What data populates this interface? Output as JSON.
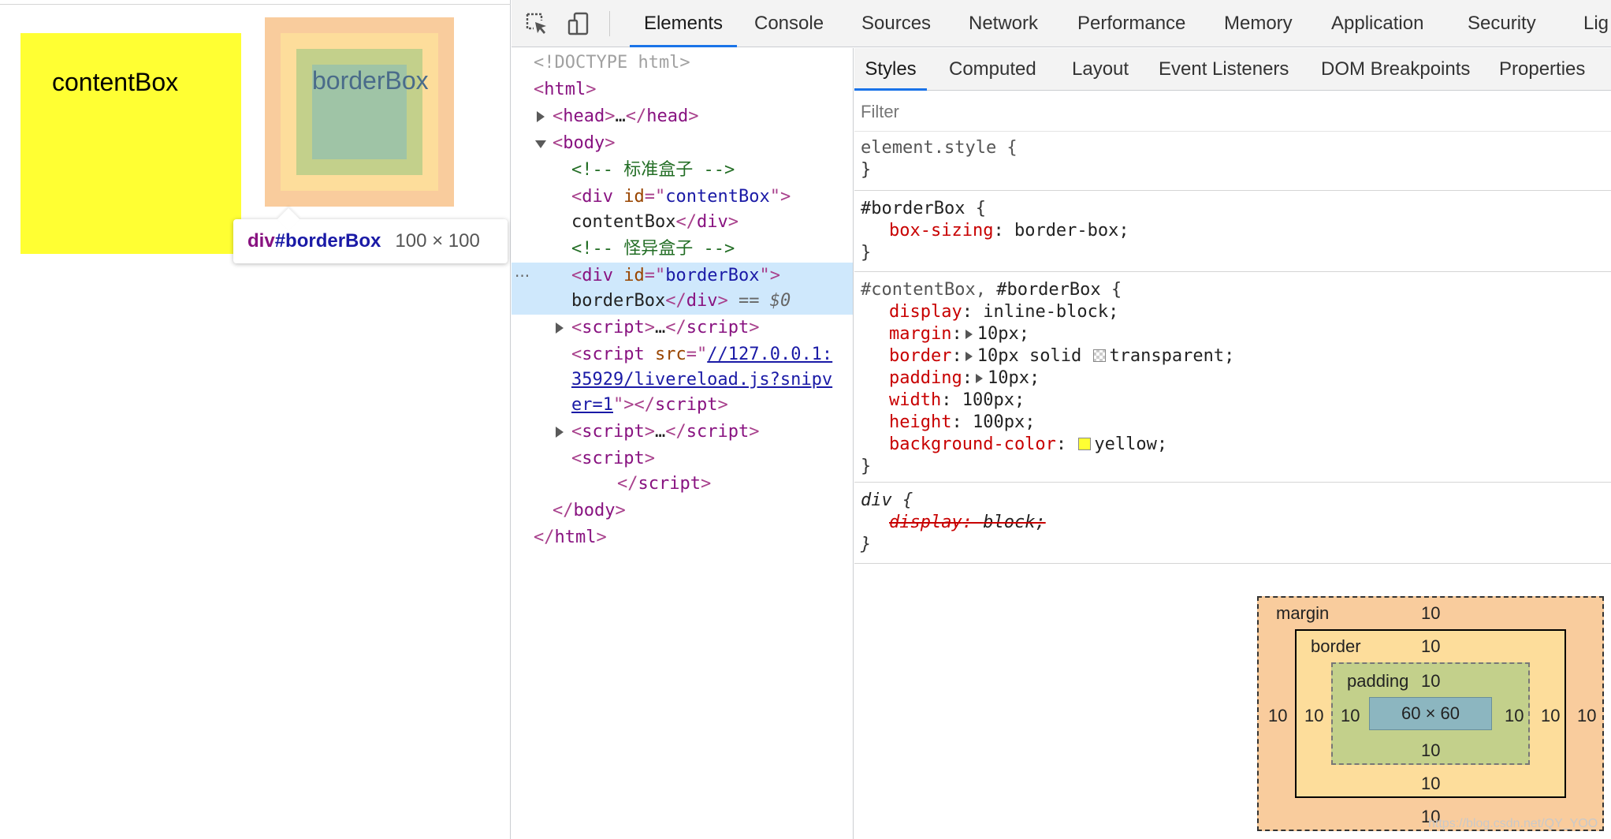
{
  "preview": {
    "content_box_label": "contentBox",
    "border_box_label": "borderBox",
    "tooltip": {
      "tag": "div",
      "id": "#borderBox",
      "dims": "100 × 100"
    }
  },
  "devtools": {
    "tabs": [
      "Elements",
      "Console",
      "Sources",
      "Network",
      "Performance",
      "Memory",
      "Application",
      "Security",
      "Lig"
    ],
    "active_tab": "Elements",
    "dom": {
      "doctype": "<!DOCTYPE html>",
      "html_open": "html",
      "head_tag": "head",
      "body_tag": "body",
      "comment1": "<!-- 标准盒子 -->",
      "div_tag": "div",
      "id_attr": "id",
      "content_id": "contentBox",
      "content_text": "contentBox",
      "comment2": "<!-- 怪异盒子 -->",
      "border_id": "borderBox",
      "border_text": "borderBox",
      "selected_marker": "== $0",
      "script_tag": "script",
      "src_attr": "src",
      "src_line1": "//127.0.0.1:",
      "src_line2": "35929/livereload.js?snipv",
      "src_line3": "er=1",
      "ellipsis": "…",
      "dots": "···"
    },
    "styles": {
      "subtabs": [
        "Styles",
        "Computed",
        "Layout",
        "Event Listeners",
        "DOM Breakpoints",
        "Properties"
      ],
      "active_subtab": "Styles",
      "filter_placeholder": "Filter",
      "element_style_selector": "element.style {",
      "rule1_selector": "#borderBox",
      "rule1_props": [
        {
          "name": "box-sizing",
          "value": "border-box;"
        }
      ],
      "rule2_selector_dim": "#contentBox,",
      "rule2_selector": "#borderBox",
      "rule2_props": [
        {
          "name": "display",
          "value": "inline-block;"
        },
        {
          "name": "margin",
          "value": "10px;"
        },
        {
          "name": "border",
          "value_pre": "10px solid",
          "value_post": "transparent;"
        },
        {
          "name": "padding",
          "value": "10px;"
        },
        {
          "name": "width",
          "value": "100px;"
        },
        {
          "name": "height",
          "value": "100px;"
        },
        {
          "name": "background-color",
          "value": "yellow;"
        }
      ],
      "rule3_selector": "div",
      "rule3_props": [
        {
          "name": "display",
          "value": "block;"
        }
      ],
      "open_brace": "{",
      "close_brace": "}"
    },
    "box_model": {
      "margin_label": "margin",
      "border_label": "border",
      "padding_label": "padding",
      "margin": {
        "top": "10",
        "right": "10",
        "bottom": "10",
        "left": "10"
      },
      "border": {
        "top": "10",
        "right": "10",
        "bottom": "10",
        "left": "10"
      },
      "padding": {
        "top": "10",
        "right": "10",
        "bottom": "10",
        "left": "10"
      },
      "content": "60 × 60"
    }
  },
  "watermark": "https://blog.csdn.net/QY_YOO"
}
